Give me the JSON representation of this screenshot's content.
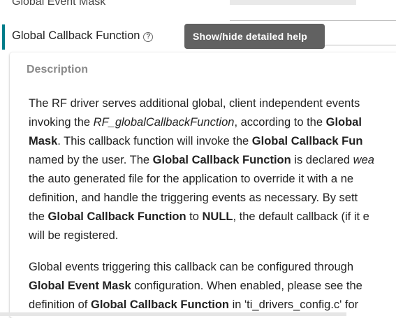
{
  "previous_field": {
    "label": "Global Event Mask"
  },
  "field": {
    "label": "Global Callback Function",
    "help_icon": "question-circle-icon",
    "help_icon_glyph": "?"
  },
  "tooltip": {
    "text": "Show/hide detailed help"
  },
  "help": {
    "title": "Description",
    "p1": {
      "l1": "The RF driver serves additional global, client independent events",
      "l2a": "invoking the ",
      "l2b": "RF_globalCallbackFunction",
      "l2c": ", according to the ",
      "l2d": "Global",
      "l3a": "Mask",
      "l3b": ". This callback function will invoke the ",
      "l3c": "Global Callback Fun",
      "l4a": "named by the user. The ",
      "l4b": "Global Callback Function",
      "l4c": " is declared ",
      "l4d": "wea",
      "l5": "the auto generated file for the application to override it with a ne",
      "l6": "definition, and handle the triggering events as necessary. By sett",
      "l7a": "the ",
      "l7b": "Global Callback Function",
      "l7c": " to ",
      "l7d": "NULL",
      "l7e": ", the default callback (if it e",
      "l8": "will be registered."
    },
    "p2": {
      "l1": "Global events triggering this callback can be configured through",
      "l2a": "Global Event Mask",
      "l2b": " configuration. When enabled, please see the",
      "l3a": "definition of ",
      "l3b": "Global Callback Function",
      "l3c": " in 'ti_drivers_config.c' for"
    }
  },
  "colors": {
    "accent": "#007c8a",
    "tooltip_bg": "#616161",
    "title_gray": "#8a8a8a"
  }
}
